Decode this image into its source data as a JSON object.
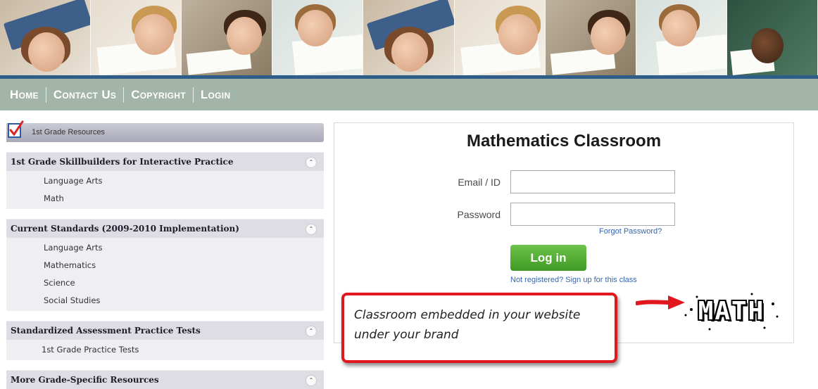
{
  "nav": {
    "items": [
      "Home",
      "Contact Us",
      "Copyright",
      "Login"
    ]
  },
  "sidebar": {
    "title": "1st Grade Resources",
    "sections": [
      {
        "heading": "1st Grade Skillbuilders for Interactive Practice",
        "links": [
          "Language Arts",
          "Math"
        ]
      },
      {
        "heading": "Current Standards (2009-2010 Implementation)",
        "links": [
          "Language Arts",
          "Mathematics",
          "Science",
          "Social Studies"
        ]
      },
      {
        "heading": "Standardized Assessment Practice Tests",
        "links": [
          "1st Grade Practice Tests"
        ]
      },
      {
        "heading": "More Grade-Specific Resources",
        "links": []
      }
    ],
    "collapse_glyph": "⌃"
  },
  "login": {
    "title": "Mathematics Classroom",
    "email_label": "Email / ID",
    "password_label": "Password",
    "forgot_label": "Forgot Password?",
    "button_label": "Log in",
    "signup_label": "Not registered? Sign up for this class"
  },
  "callout": {
    "text": "Classroom embedded in your website under your brand"
  },
  "logo": {
    "text": "MATH"
  },
  "colors": {
    "nav_bg": "#a3b5a8",
    "banner_bar": "#2f5d8a",
    "login_button": "#4aa82e",
    "link": "#3465b0",
    "callout_border": "#e0181d"
  }
}
